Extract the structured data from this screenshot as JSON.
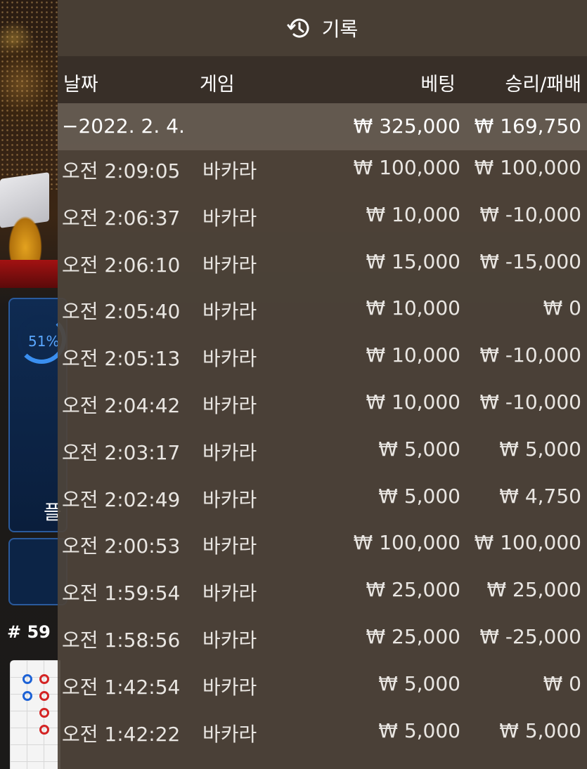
{
  "background": {
    "percent_label": "51%",
    "panel_char": "플",
    "round_label": "# 59",
    "colors": {
      "panel_blue": "#0f2b52",
      "accent_blue": "#3a8ff0",
      "road_red": "#d42424",
      "road_blue": "#1d62d6"
    }
  },
  "history": {
    "icon": "history-clock-icon",
    "title": "기록",
    "columns": {
      "date": "날짜",
      "game": "게임",
      "bet": "베팅",
      "winloss": "승리/패배"
    },
    "summary": {
      "date": "−2022. 2. 4.",
      "bet": "₩ 325,000",
      "winloss": "₩ 169,750"
    },
    "rows": [
      {
        "time": "오전 2:09:05",
        "game": "바카라",
        "bet": "₩ 100,000",
        "winloss": "₩ 100,000"
      },
      {
        "time": "오전 2:06:37",
        "game": "바카라",
        "bet": "₩ 10,000",
        "winloss": "₩ -10,000"
      },
      {
        "time": "오전 2:06:10",
        "game": "바카라",
        "bet": "₩ 15,000",
        "winloss": "₩ -15,000"
      },
      {
        "time": "오전 2:05:40",
        "game": "바카라",
        "bet": "₩ 10,000",
        "winloss": "₩ 0"
      },
      {
        "time": "오전 2:05:13",
        "game": "바카라",
        "bet": "₩ 10,000",
        "winloss": "₩ -10,000"
      },
      {
        "time": "오전 2:04:42",
        "game": "바카라",
        "bet": "₩ 10,000",
        "winloss": "₩ -10,000"
      },
      {
        "time": "오전 2:03:17",
        "game": "바카라",
        "bet": "₩ 5,000",
        "winloss": "₩ 5,000"
      },
      {
        "time": "오전 2:02:49",
        "game": "바카라",
        "bet": "₩ 5,000",
        "winloss": "₩ 4,750"
      },
      {
        "time": "오전 2:00:53",
        "game": "바카라",
        "bet": "₩ 100,000",
        "winloss": "₩ 100,000"
      },
      {
        "time": "오전 1:59:54",
        "game": "바카라",
        "bet": "₩ 25,000",
        "winloss": "₩ 25,000"
      },
      {
        "time": "오전 1:58:56",
        "game": "바카라",
        "bet": "₩ 25,000",
        "winloss": "₩ -25,000"
      },
      {
        "time": "오전 1:42:54",
        "game": "바카라",
        "bet": "₩ 5,000",
        "winloss": "₩ 0"
      },
      {
        "time": "오전 1:42:22",
        "game": "바카라",
        "bet": "₩ 5,000",
        "winloss": "₩ 5,000"
      }
    ]
  }
}
